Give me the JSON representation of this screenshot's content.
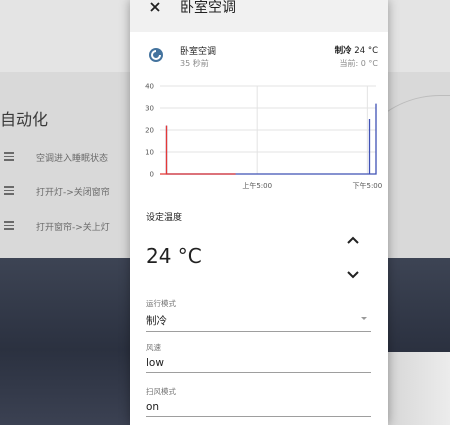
{
  "background": {
    "section_title": "自动化",
    "automations": [
      {
        "label": "空调进入睡眠状态"
      },
      {
        "label": "打开灯->关闭窗帘"
      },
      {
        "label": "打开窗帘->关上灯"
      }
    ]
  },
  "dialog": {
    "title": "卧室空调",
    "close_icon": "close-icon",
    "entity": {
      "name": "卧室空调",
      "last_changed": "35 秒前",
      "state_mode": "制冷",
      "state_temp": "24 °C",
      "current_temp": "当前: 0 °C",
      "icon": "climate-icon"
    },
    "chart_data": {
      "type": "line",
      "y_ticks": [
        "40",
        "30",
        "20",
        "10",
        "0"
      ],
      "ylim": [
        0,
        40
      ],
      "x_ticks": [
        "上午5:00",
        "下午5:00"
      ],
      "series": [
        {
          "color": "#3f51b5",
          "points": [
            [
              0.03,
              0
            ],
            [
              0.03,
              22
            ],
            [
              0.03,
              0
            ],
            [
              0.97,
              0
            ],
            [
              0.97,
              25
            ],
            [
              0.97,
              0
            ],
            [
              1.0,
              0
            ],
            [
              1.0,
              32
            ]
          ]
        },
        {
          "color": "#e53935",
          "points": [
            [
              0.0,
              0
            ],
            [
              0.03,
              0
            ],
            [
              0.03,
              22
            ],
            [
              0.03,
              0
            ],
            [
              0.35,
              0
            ]
          ]
        }
      ],
      "grid": true
    },
    "setpoint": {
      "label": "设定温度",
      "value": "24 °C",
      "up_icon": "chevron-up-icon",
      "down_icon": "chevron-down-icon"
    },
    "fields": [
      {
        "label": "运行模式",
        "value": "制冷",
        "has_dropdown": true
      },
      {
        "label": "风速",
        "value": "low",
        "has_dropdown": false
      },
      {
        "label": "扫风模式",
        "value": "on",
        "has_dropdown": false
      }
    ]
  }
}
